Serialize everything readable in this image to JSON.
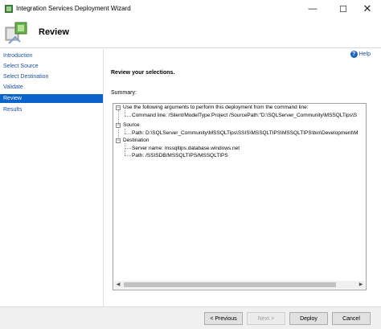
{
  "window": {
    "title": "Integration Services Deployment Wizard",
    "minimize_glyph": "—",
    "maximize_glyph": "☐",
    "close_glyph": "✕"
  },
  "header": {
    "title": "Review"
  },
  "sidebar": {
    "items": [
      {
        "label": "Introduction",
        "active": false
      },
      {
        "label": "Select Source",
        "active": false
      },
      {
        "label": "Select Destination",
        "active": false
      },
      {
        "label": "Validate",
        "active": false
      },
      {
        "label": "Review",
        "active": true
      },
      {
        "label": "Results",
        "active": false
      }
    ],
    "active_color": "#0a63c9",
    "link_color": "#1a4f9c"
  },
  "content": {
    "help_label": "Help",
    "heading": "Review your selections.",
    "summary_label": "Summary:",
    "tree": {
      "arguments_node": "Use the following arguments to perform this deployment from the command line:",
      "command_line": "Command line: /Silent/ModelType:Project /SourcePath:\"D:\\SQLServer_Community\\MSSQLTips\\S",
      "source_node": "Source",
      "source_path": "Path: D:\\SQLServer_Community\\MSSQLTips\\SSIS\\MSSQLTIPS\\MSSQLTIPS\\bin\\Development\\M",
      "destination_node": "Destination",
      "server_name": "Server name: mssqltips.database.windows.net",
      "destination_path": "Path: /SSISDB/MSSQLTIPS/MSSQLTIPS"
    }
  },
  "footer": {
    "previous": "< Previous",
    "next": "Next >",
    "deploy": "Deploy",
    "cancel": "Cancel"
  }
}
